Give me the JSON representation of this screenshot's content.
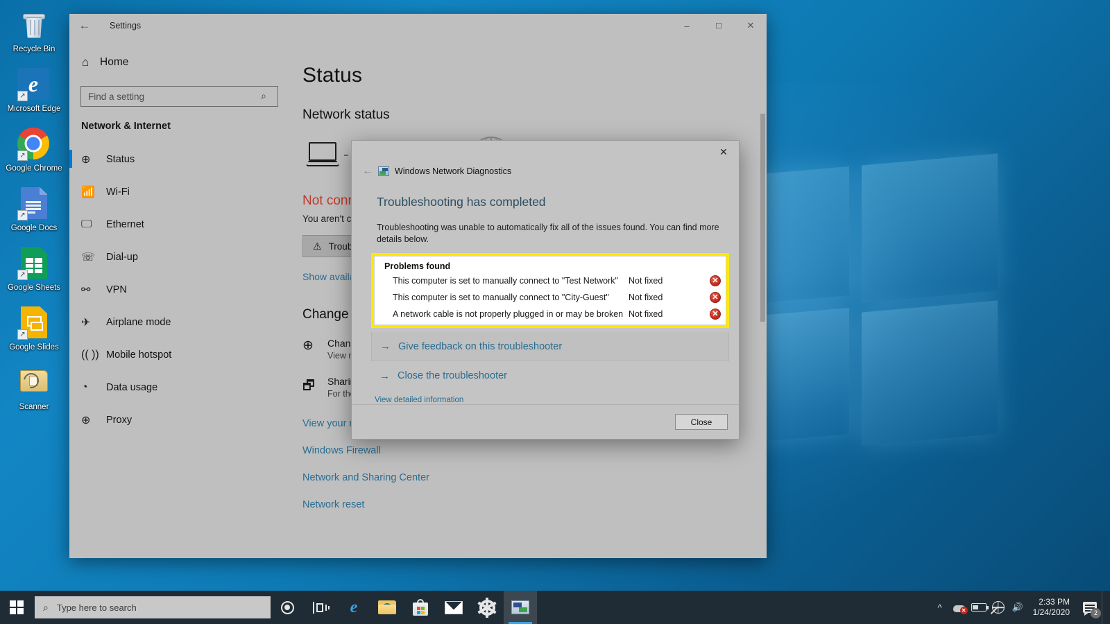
{
  "desktop": {
    "icons": [
      {
        "name": "recycle-bin",
        "label": "Recycle Bin"
      },
      {
        "name": "microsoft-edge",
        "label": "Microsoft Edge"
      },
      {
        "name": "google-chrome",
        "label": "Google Chrome"
      },
      {
        "name": "google-docs",
        "label": "Google Docs"
      },
      {
        "name": "google-sheets",
        "label": "Google Sheets"
      },
      {
        "name": "google-slides",
        "label": "Google Slides"
      },
      {
        "name": "scanner",
        "label": "Scanner"
      }
    ]
  },
  "settings_window": {
    "title": "Settings",
    "back_icon": "back-arrow-icon",
    "controls": {
      "minimize": "–",
      "maximize": "☐",
      "close": "✕"
    },
    "sidebar": {
      "home_label": "Home",
      "home_icon": "home-icon",
      "search": {
        "placeholder": "Find a setting",
        "value": "",
        "icon": "search-icon"
      },
      "category": "Network & Internet",
      "items": [
        {
          "label": "Status",
          "icon": "globe-status-icon",
          "active": true
        },
        {
          "label": "Wi-Fi",
          "icon": "wifi-icon",
          "active": false
        },
        {
          "label": "Ethernet",
          "icon": "ethernet-icon",
          "active": false
        },
        {
          "label": "Dial-up",
          "icon": "dialup-phone-icon",
          "active": false
        },
        {
          "label": "VPN",
          "icon": "vpn-icon",
          "active": false
        },
        {
          "label": "Airplane mode",
          "icon": "airplane-icon",
          "active": false
        },
        {
          "label": "Mobile hotspot",
          "icon": "hotspot-icon",
          "active": false
        },
        {
          "label": "Data usage",
          "icon": "pie-chart-icon",
          "active": false
        },
        {
          "label": "Proxy",
          "icon": "globe-icon",
          "active": false
        }
      ]
    },
    "main": {
      "page_title": "Status",
      "section_title": "Network status",
      "diagram": {
        "device_icon": "laptop-icon",
        "link_icon": "dashed-link",
        "internet_icon": "globe-icon"
      },
      "status_heading": "Not connected",
      "status_sub": "You aren't connected to any networks.",
      "troubleshoot_button": {
        "label": "Troubleshoot",
        "icon": "warning-triangle-icon"
      },
      "show_networks_link": "Show available networks",
      "change_heading": "Change your network settings",
      "options": [
        {
          "icon": "adapter-options-icon",
          "title": "Change adapter options",
          "subtitle": "View network adapters and change connection settings."
        },
        {
          "icon": "sharing-options-icon",
          "title": "Sharing options",
          "subtitle": "For the networks you connect to, decide what you want to share."
        }
      ],
      "links": [
        "View your network properties",
        "Windows Firewall",
        "Network and Sharing Center",
        "Network reset"
      ]
    }
  },
  "dialog": {
    "title": "Windows Network Diagnostics",
    "app_icon": "network-diagnostics-icon",
    "back_icon": "back-arrow-icon",
    "close_icon": "close-icon",
    "heading": "Troubleshooting has completed",
    "description": "Troubleshooting was unable to automatically fix all of the issues found. You can find more details below.",
    "problems": {
      "title": "Problems found",
      "highlight_color": "#ffe800",
      "rows": [
        {
          "text": "This computer is set to manually connect to \"Test Network\"",
          "state": "Not fixed",
          "icon": "error-icon"
        },
        {
          "text": "This computer is set to manually connect to \"City-Guest\"",
          "state": "Not fixed",
          "icon": "error-icon"
        },
        {
          "text": "A network cable is not properly plugged in or may be broken",
          "state": "Not fixed",
          "icon": "error-icon"
        }
      ]
    },
    "actions": [
      {
        "label": "Give feedback on this troubleshooter",
        "icon": "arrow-right-icon"
      },
      {
        "label": "Close the troubleshooter",
        "icon": "arrow-right-icon"
      }
    ],
    "detail_link": "View detailed information",
    "close_button": "Close"
  },
  "taskbar": {
    "start_icon": "windows-start-icon",
    "search": {
      "placeholder": "Type here to search",
      "icon": "search-icon"
    },
    "items": [
      {
        "name": "cortana-icon"
      },
      {
        "name": "task-view-icon"
      },
      {
        "name": "microsoft-edge-icon"
      },
      {
        "name": "file-explorer-icon"
      },
      {
        "name": "microsoft-store-icon"
      },
      {
        "name": "mail-icon"
      },
      {
        "name": "settings-gear-icon"
      },
      {
        "name": "network-diagnostics-icon"
      }
    ],
    "tray": {
      "overflow_icon": "chevron-up-icon",
      "onedrive_icon": "onedrive-error-icon",
      "battery_icon": "battery-icon",
      "network_icon": "network-disconnected-icon",
      "volume_icon": "speaker-icon",
      "time": "2:33 PM",
      "date": "1/24/2020",
      "notification_count": "2"
    }
  }
}
